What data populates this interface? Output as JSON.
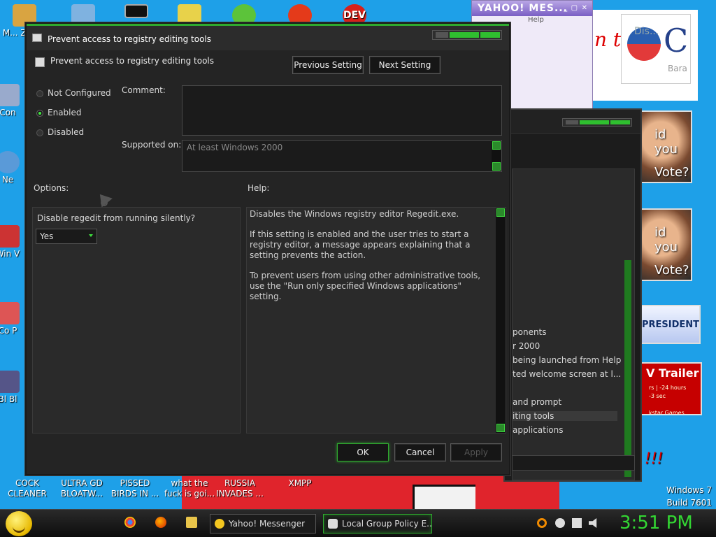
{
  "desktop": {
    "top_icons": [
      {
        "label": "M... ZUC..."
      },
      {
        "label": ""
      },
      {
        "label": ""
      },
      {
        "label": ""
      },
      {
        "label": ""
      },
      {
        "label": ""
      },
      {
        "label": "DEV"
      }
    ],
    "left_partials": [
      "Con",
      "Ne",
      "Win V",
      "Co P",
      "Bl Bl"
    ],
    "bottom_icons": [
      {
        "label": "COCK CLEANER"
      },
      {
        "label": "ULTRA GD BLOATW..."
      },
      {
        "label": "PISSED BIRDS IN ..."
      },
      {
        "label": "what the fuck is goi..."
      },
      {
        "label": "RUSSIA INVADES ..."
      },
      {
        "label": "XMPP"
      }
    ],
    "watermark": {
      "line1": "Windows 7",
      "line2": "Build 7601"
    }
  },
  "yahoo_window": {
    "title": "YAHOO! MES...",
    "menu": "Help"
  },
  "ads": {
    "obama": {
      "text1": "Dis...",
      "text2": "Bara"
    },
    "red_text": "n t",
    "face1": {
      "line1": "id you",
      "line2": "Vote?"
    },
    "face2": {
      "line1": "id you",
      "line2": "Vote?"
    },
    "president": "PRESIDENT",
    "trailer": {
      "title": "V Trailer",
      "line1": "rs | -24 hours",
      "line2": "-3 sec",
      "line3": "kstar Games"
    },
    "exclaim": "!!!"
  },
  "bg_window": {
    "lines": [
      "ponents",
      "r 2000",
      "being launched from Help",
      "ted welcome screen at l...",
      "and prompt",
      "iting tools",
      "applications"
    ]
  },
  "dialog": {
    "title": "Prevent access to registry editing tools",
    "setting_title": "Prevent access to registry editing tools",
    "prev_button": "Previous Setting",
    "next_button": "Next Setting",
    "radios": [
      {
        "label": "Not Configured",
        "selected": false
      },
      {
        "label": "Enabled",
        "selected": true
      },
      {
        "label": "Disabled",
        "selected": false
      }
    ],
    "comment_label": "Comment:",
    "comment_value": "",
    "supported_label": "Supported on:",
    "supported_value": "At least Windows 2000",
    "options_label": "Options:",
    "help_label": "Help:",
    "option_question": "Disable regedit from running silently?",
    "option_value": "Yes",
    "help_paragraphs": [
      "Disables the Windows registry editor Regedit.exe.",
      "If this setting is enabled and the user tries to start a registry editor, a message appears explaining that a setting prevents the action.",
      "To prevent users from using other administrative tools, use the \"Run only specified Windows applications\" setting."
    ],
    "ok_button": "OK",
    "cancel_button": "Cancel",
    "apply_button": "Apply"
  },
  "taskbar": {
    "tasks": [
      {
        "label": "Yahoo! Messenger",
        "active": false
      },
      {
        "label": "Local Group Policy E...",
        "active": true
      }
    ],
    "clock": "3:51 PM"
  },
  "colors": {
    "accent": "#2faa2f",
    "desktop": "#1ea0e8",
    "dialog_bg": "#242424"
  }
}
